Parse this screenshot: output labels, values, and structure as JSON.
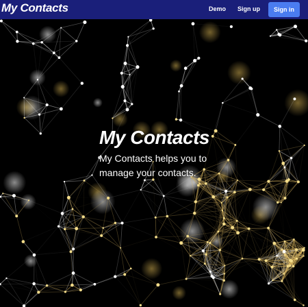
{
  "navbar": {
    "brand": "My Contacts",
    "links": [
      {
        "label": "Demo"
      },
      {
        "label": "Sign up"
      }
    ],
    "signin_label": "Sign in"
  },
  "hero": {
    "title": "My Contacts",
    "subtitle": "My Contacts helps you to manage your contacts."
  },
  "colors": {
    "navbar_bg": "#1a1f7a",
    "signin_bg": "#4a7cf0",
    "network_light": "#ffffff",
    "network_gold": "#e8c25a"
  }
}
